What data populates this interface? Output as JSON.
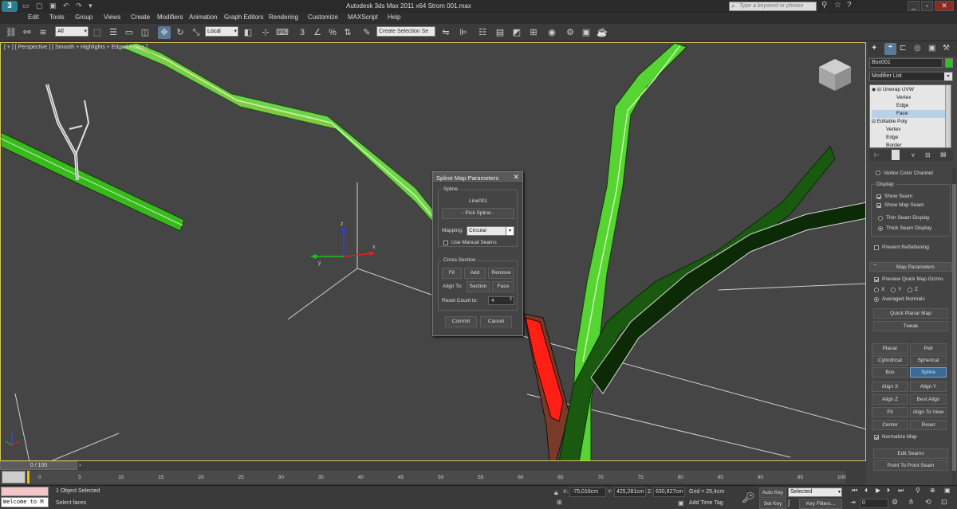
{
  "app": {
    "title": "Autodesk 3ds Max  2011 x64     Strom 001.max",
    "search_placeholder": "Type a keyword or phrase"
  },
  "menu": [
    "Edit",
    "Tools",
    "Group",
    "Views",
    "Create",
    "Modifiers",
    "Animation",
    "Graph Editors",
    "Rendering",
    "Customize",
    "MAXScript",
    "Help"
  ],
  "toolbar": {
    "selection_filter": "All",
    "coord_system": "Local",
    "named_selection_placeholder": "Create Selection Se"
  },
  "viewport": {
    "label": "[ + ] [ Perspective ] [ Smooth + Highlights + Edged Faces ]"
  },
  "dialog": {
    "title": "Spline Map Parameters",
    "spline_group": "Spline",
    "spline_name": "Line001",
    "pick_spline": "- Pick Spline -",
    "mapping_label": "Mapping:",
    "mapping_value": "Circular",
    "manual_seams_label": "Use Manual Seams",
    "cross_section_group": "Cross Section",
    "fit": "Fit",
    "add": "Add",
    "remove": "Remove",
    "align_to_label": "Align To:",
    "section": "Section",
    "face": "Face",
    "reset_count_label": "Reset Count to:",
    "reset_count_value": "4",
    "commit": "Commit",
    "cancel": "Cancel"
  },
  "panel": {
    "object_name": "Box001",
    "modifier_list": "Modifier List",
    "stack": [
      "Unwrap UVW",
      "Vertex",
      "Edge",
      "Face",
      "Editable Poly",
      "Vertex",
      "Edge",
      "Border"
    ],
    "selected_stack_item": "Face",
    "vertex_color_channel": "Vertex Color Channel",
    "display_label": "Display:",
    "show_seam": "Show Seam",
    "show_map_seam": "Show Map Seam",
    "thin_seam": "Thin Seam Display",
    "thick_seam": "Thick Seam Display",
    "prevent_reflattening": "Prevent Reflattening",
    "map_parameters_title": "Map Parameters",
    "preview_gizmo": "Preview Quick Map Gizmo",
    "axis_x": "X",
    "axis_y": "Y",
    "axis_z": "Z",
    "averaged_normals": "Averaged Normals",
    "quick_planar_map": "Quick Planar Map",
    "tweak": "Tweak",
    "planar": "Planar",
    "pelt": "Pelt",
    "cylindrical": "Cylindrical",
    "spherical": "Spherical",
    "box": "Box",
    "spline": "Spline",
    "align_x": "Align X",
    "align_y": "Align Y",
    "align_z": "Align Z",
    "best_align": "Best Align",
    "fit": "Fit",
    "align_to_view": "Align To View",
    "center": "Center",
    "reset": "Reset",
    "normalize_map": "Normalize Map",
    "edit_seams": "Edit Seams",
    "point_to_point_seam": "Point To Point Seam"
  },
  "timeline": {
    "frame_counter": "0 / 100",
    "ticks": [
      "0",
      "5",
      "10",
      "15",
      "20",
      "25",
      "30",
      "35",
      "40",
      "45",
      "50",
      "55",
      "60",
      "65",
      "70",
      "75",
      "80",
      "85",
      "90",
      "95",
      "100"
    ]
  },
  "status": {
    "listener": "Welcome to M",
    "selection_count": "1 Object Selected",
    "prompt": "Select faces",
    "x_label": "X:",
    "x_value": "-75,016cm",
    "y_label": "Y:",
    "y_value": "425,281cm",
    "z_label": "Z:",
    "z_value": "630,827cm",
    "grid": "Grid = 25,4cm",
    "add_time_tag": "Add Time Tag",
    "auto_key": "Auto Key",
    "auto_key_mode": "Selected",
    "set_key": "Set Key",
    "key_filters": "Key Filters...",
    "current_frame": "0"
  }
}
